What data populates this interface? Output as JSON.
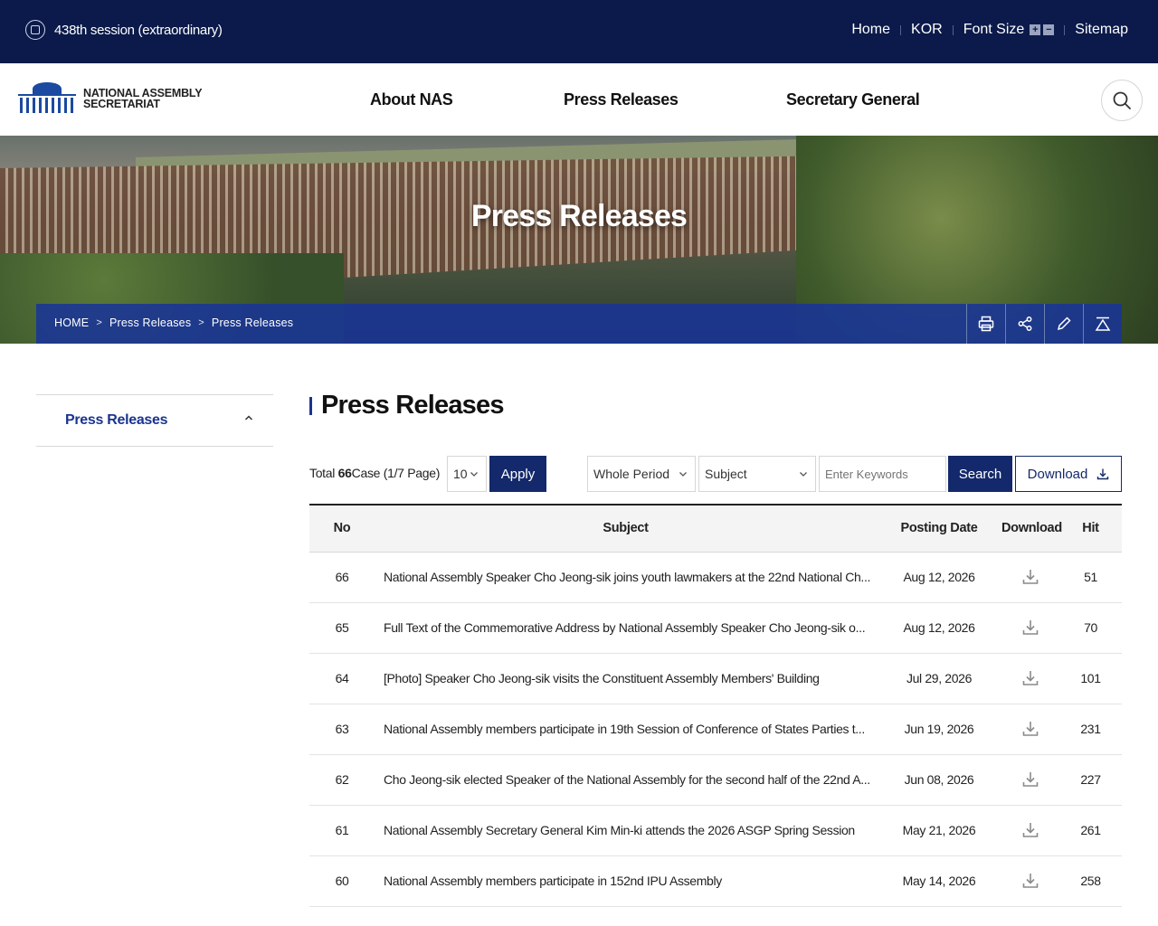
{
  "topbar": {
    "session": "438th session (extraordinary)",
    "nav": {
      "home": "Home",
      "kor": "KOR",
      "font_size": "Font Size",
      "plus": "+",
      "minus": "−",
      "sitemap": "Sitemap"
    }
  },
  "header": {
    "logo_line1": "NATIONAL ASSEMBLY",
    "logo_line2": "SECRETARIAT",
    "menu": [
      "About NAS",
      "Press Releases",
      "Secretary General"
    ]
  },
  "hero": {
    "title": "Press Releases",
    "breadcrumb": [
      "HOME",
      "Press Releases",
      "Press Releases"
    ]
  },
  "sidebar": {
    "label": "Press Releases"
  },
  "content": {
    "title": "Press Releases",
    "total_prefix": "Total",
    "total_count": "66",
    "total_suffix": "Case (1/7 Page)",
    "page_size": "10",
    "apply": "Apply",
    "period": "Whole Period",
    "field": "Subject",
    "keyword_placeholder": "Enter Keywords",
    "search": "Search",
    "download": "Download"
  },
  "table": {
    "headers": [
      "No",
      "Subject",
      "Posting Date",
      "Download",
      "Hit"
    ],
    "rows": [
      {
        "no": "66",
        "subject": "National Assembly Speaker Cho Jeong-sik joins youth lawmakers at the 22nd National Ch...",
        "date": "Aug 12, 2026",
        "hit": "51"
      },
      {
        "no": "65",
        "subject": "Full Text of the Commemorative Address by National Assembly Speaker Cho Jeong-sik o...",
        "date": "Aug 12, 2026",
        "hit": "70"
      },
      {
        "no": "64",
        "subject": "[Photo] Speaker Cho Jeong-sik visits the Constituent Assembly Members' Building",
        "date": "Jul 29, 2026",
        "hit": "101"
      },
      {
        "no": "63",
        "subject": "National Assembly members participate in 19th Session of Conference of States Parties t...",
        "date": "Jun 19, 2026",
        "hit": "231"
      },
      {
        "no": "62",
        "subject": "Cho Jeong-sik elected Speaker of the National Assembly for the second half of the 22nd A...",
        "date": "Jun 08, 2026",
        "hit": "227"
      },
      {
        "no": "61",
        "subject": "National Assembly Secretary General Kim Min-ki attends the 2026 ASGP Spring Session",
        "date": "May 21, 2026",
        "hit": "261"
      },
      {
        "no": "60",
        "subject": "National Assembly members participate in 152nd IPU Assembly",
        "date": "May 14, 2026",
        "hit": "258"
      }
    ]
  }
}
